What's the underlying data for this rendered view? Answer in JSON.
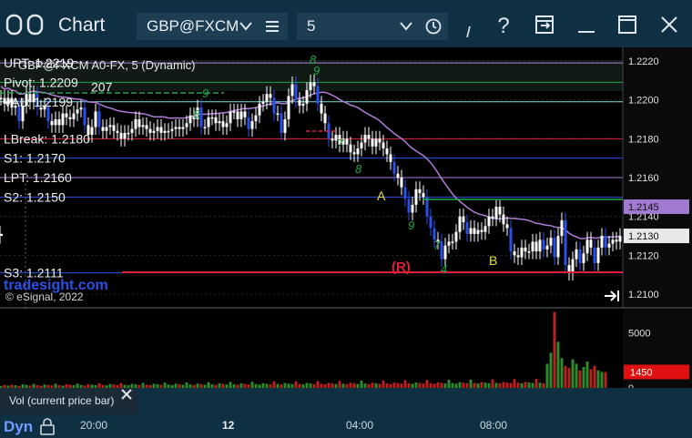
{
  "toolbar": {
    "title": "Chart",
    "symbol": "GBP@FXCM",
    "interval": "5",
    "icons": [
      "chart-layout-icon",
      "chevron-down-icon",
      "menu-icon",
      "chevron-down-icon",
      "clock-icon",
      "cursor-icon",
      "help-icon",
      "export-icon",
      "minimize-icon",
      "maximize-icon",
      "close-icon"
    ]
  },
  "chart_header": "GBP@FXCM A0-FX, 5 (Dynamic)",
  "levels": [
    {
      "label": "UPT: 1.2219",
      "value": 1.2219,
      "color": "#b07cd8"
    },
    {
      "label": "Pivot: 1.2209",
      "value": 1.2209,
      "color": "#1fa84a",
      "extra": "207"
    },
    {
      "label": "VAL: 1.2199",
      "value": 1.2199,
      "color": "#7fe0e0"
    },
    {
      "label": "LBreak: 1.2180",
      "value": 1.218,
      "color": "#e0203a"
    },
    {
      "label": "S1: 1.2170",
      "value": 1.217,
      "color": "#2a50e8"
    },
    {
      "label": "LPT: 1.2160",
      "value": 1.216,
      "color": "#b07cd8"
    },
    {
      "label": "S2: 1.2150",
      "value": 1.215,
      "color": "#2a50e8"
    },
    {
      "label": "S3: 1.2111",
      "value": 1.2111,
      "color": "#2a50e8"
    }
  ],
  "right_axis": {
    "ticks": [
      "1.2220",
      "1.2200",
      "1.2180",
      "1.2160",
      "1.2140",
      "1.2120",
      "1.2100"
    ],
    "tick_values": [
      1.222,
      1.22,
      1.218,
      1.216,
      1.214,
      1.212,
      1.21
    ],
    "badges": [
      {
        "text": "1.2145",
        "value": 1.2145,
        "color": "#a07ad0"
      },
      {
        "text": "1.2130",
        "value": 1.213,
        "color": "#e8e8e8"
      }
    ]
  },
  "markers": [
    {
      "text": "A",
      "color": "#e8e04a"
    },
    {
      "text": "B",
      "color": "#e8e04a"
    },
    {
      "text": "(R)",
      "color": "#e0203a"
    }
  ],
  "brand": {
    "site": "tradesight.com",
    "copyright": "© eSignal, 2022"
  },
  "volume_panel": {
    "ticks": [
      "5000",
      "0"
    ],
    "tick_values": [
      5000,
      0
    ],
    "badge": "1450",
    "badge_value": 1450,
    "study_label": "Vol (current price bar)"
  },
  "time_axis": {
    "labels": [
      "20:00",
      "12",
      "04:00",
      "08:00"
    ],
    "dyn_label": "Dyn"
  },
  "chart_data": {
    "type": "candlestick",
    "ylim": [
      1.2093,
      1.2227
    ],
    "volume_ylim": [
      0,
      7200
    ],
    "x": [
      1,
      5,
      9,
      13,
      17,
      21,
      25,
      29,
      33,
      37,
      41,
      45,
      49,
      53,
      57,
      61,
      65,
      69,
      73,
      77,
      81,
      85,
      89,
      93,
      97,
      101,
      105,
      109,
      113,
      117,
      121,
      125,
      129,
      133,
      137,
      141,
      145,
      149,
      153,
      157,
      161,
      165,
      169,
      173,
      177,
      181,
      185,
      189,
      193,
      197,
      201,
      205,
      209,
      213,
      217,
      221,
      225,
      229,
      233,
      237,
      241,
      245,
      249,
      253,
      257,
      261,
      265,
      269,
      273,
      277,
      281,
      285,
      289,
      293,
      297,
      301,
      305,
      309,
      313,
      317,
      321,
      325,
      329,
      333,
      337,
      341,
      345,
      349,
      353,
      357,
      361,
      365,
      369,
      373,
      377,
      381,
      385,
      389,
      393,
      397,
      401,
      405,
      409,
      413,
      417,
      421,
      425,
      429,
      433,
      437,
      441,
      445,
      449,
      453,
      457,
      461,
      465,
      469,
      473,
      477,
      481,
      485,
      489,
      493,
      497,
      501,
      505,
      509,
      513,
      517,
      521,
      525,
      529,
      533,
      537,
      541,
      545,
      549,
      553,
      557,
      561,
      565,
      569,
      573,
      577,
      581,
      585,
      589,
      593,
      597,
      601,
      605,
      609,
      613,
      617,
      621,
      625,
      629,
      633,
      637,
      641,
      645,
      649,
      653,
      657,
      661,
      665,
      669,
      673,
      677,
      681
    ],
    "close": [
      1.2201,
      1.2198,
      1.2201,
      1.2196,
      1.2197,
      1.2189,
      1.2197,
      1.2203,
      1.2199,
      1.2203,
      1.2196,
      1.2195,
      1.2197,
      1.2189,
      1.2187,
      1.219,
      1.2187,
      1.2193,
      1.2191,
      1.219,
      1.2193,
      1.2195,
      1.2196,
      1.2187,
      1.2182,
      1.2186,
      1.2194,
      1.2186,
      1.2184,
      1.2186,
      1.2187,
      1.2184,
      1.2183,
      1.218,
      1.2183,
      1.2183,
      1.2185,
      1.219,
      1.2186,
      1.2187,
      1.2185,
      1.2183,
      1.2184,
      1.2186,
      1.2183,
      1.2184,
      1.2184,
      1.2185,
      1.2186,
      1.2185,
      1.2186,
      1.2188,
      1.2192,
      1.219,
      1.2196,
      1.2186,
      1.2186,
      1.2191,
      1.2191,
      1.2188,
      1.2189,
      1.2186,
      1.2188,
      1.2194,
      1.2194,
      1.219,
      1.2194,
      1.2191,
      1.2185,
      1.2189,
      1.2192,
      1.2198,
      1.2199,
      1.2203,
      1.2201,
      1.2193,
      1.2193,
      1.2183,
      1.219,
      1.2202,
      1.2208,
      1.22,
      1.2197,
      1.2198,
      1.2205,
      1.2209,
      1.2207,
      1.2198,
      1.2193,
      1.2188,
      1.218,
      1.2179,
      1.2182,
      1.2177,
      1.218,
      1.2177,
      1.2173,
      1.2172,
      1.2175,
      1.2178,
      1.2182,
      1.218,
      1.2176,
      1.218,
      1.2178,
      1.2175,
      1.2172,
      1.2168,
      1.2162,
      1.216,
      1.2155,
      1.2149,
      1.2142,
      1.2146,
      1.2154,
      1.2152,
      1.215,
      1.214,
      1.2134,
      1.2128,
      1.2127,
      1.2118,
      1.2125,
      1.2127,
      1.2127,
      1.2132,
      1.214,
      1.2137,
      1.2131,
      1.2134,
      1.2131,
      1.2133,
      1.2132,
      1.2135,
      1.214,
      1.2139,
      1.2145,
      1.2141,
      1.2136,
      1.2134,
      1.2122,
      1.212,
      1.2119,
      1.2124,
      1.2122,
      1.2122,
      1.2127,
      1.2122,
      1.2128,
      1.2123,
      1.2125,
      1.2129,
      1.2119,
      1.213,
      1.2138,
      1.2115,
      1.2111,
      1.2118,
      1.2123,
      1.2116,
      1.2121,
      1.2128,
      1.2124,
      1.2116,
      1.2124,
      1.213,
      1.2124,
      1.2126,
      1.2128,
      1.2127,
      1.213,
      1.2131,
      1.2131
    ],
    "volume": [
      180,
      260,
      210,
      300,
      240,
      190,
      330,
      280,
      220,
      360,
      250,
      200,
      310,
      270,
      230,
      380,
      260,
      210,
      340,
      290,
      240,
      400,
      270,
      220,
      350,
      300,
      250,
      420,
      280,
      230,
      360,
      310,
      260,
      440,
      290,
      240,
      370,
      320,
      270,
      460,
      300,
      250,
      380,
      330,
      280,
      480,
      310,
      260,
      390,
      340,
      290,
      500,
      320,
      270,
      400,
      350,
      300,
      520,
      330,
      280,
      410,
      360,
      310,
      540,
      340,
      290,
      420,
      370,
      320,
      560,
      350,
      300,
      430,
      380,
      330,
      580,
      360,
      310,
      440,
      390,
      340,
      600,
      370,
      320,
      450,
      400,
      350,
      620,
      380,
      330,
      460,
      410,
      360,
      640,
      390,
      340,
      470,
      420,
      370,
      660,
      400,
      350,
      480,
      430,
      380,
      680,
      410,
      360,
      490,
      440,
      390,
      700,
      420,
      370,
      500,
      450,
      400,
      720,
      430,
      380,
      510,
      460,
      410,
      740,
      440,
      390,
      520,
      470,
      420,
      760,
      450,
      400,
      530,
      480,
      430,
      780,
      460,
      410,
      540,
      490,
      440,
      800,
      470,
      420,
      550,
      500,
      450,
      820,
      480,
      430,
      2200,
      3200,
      6900,
      4200,
      2700,
      2000,
      1800,
      2600,
      2200,
      1600,
      1900,
      2400,
      1700,
      2000,
      1600,
      1450,
      1450
    ]
  }
}
